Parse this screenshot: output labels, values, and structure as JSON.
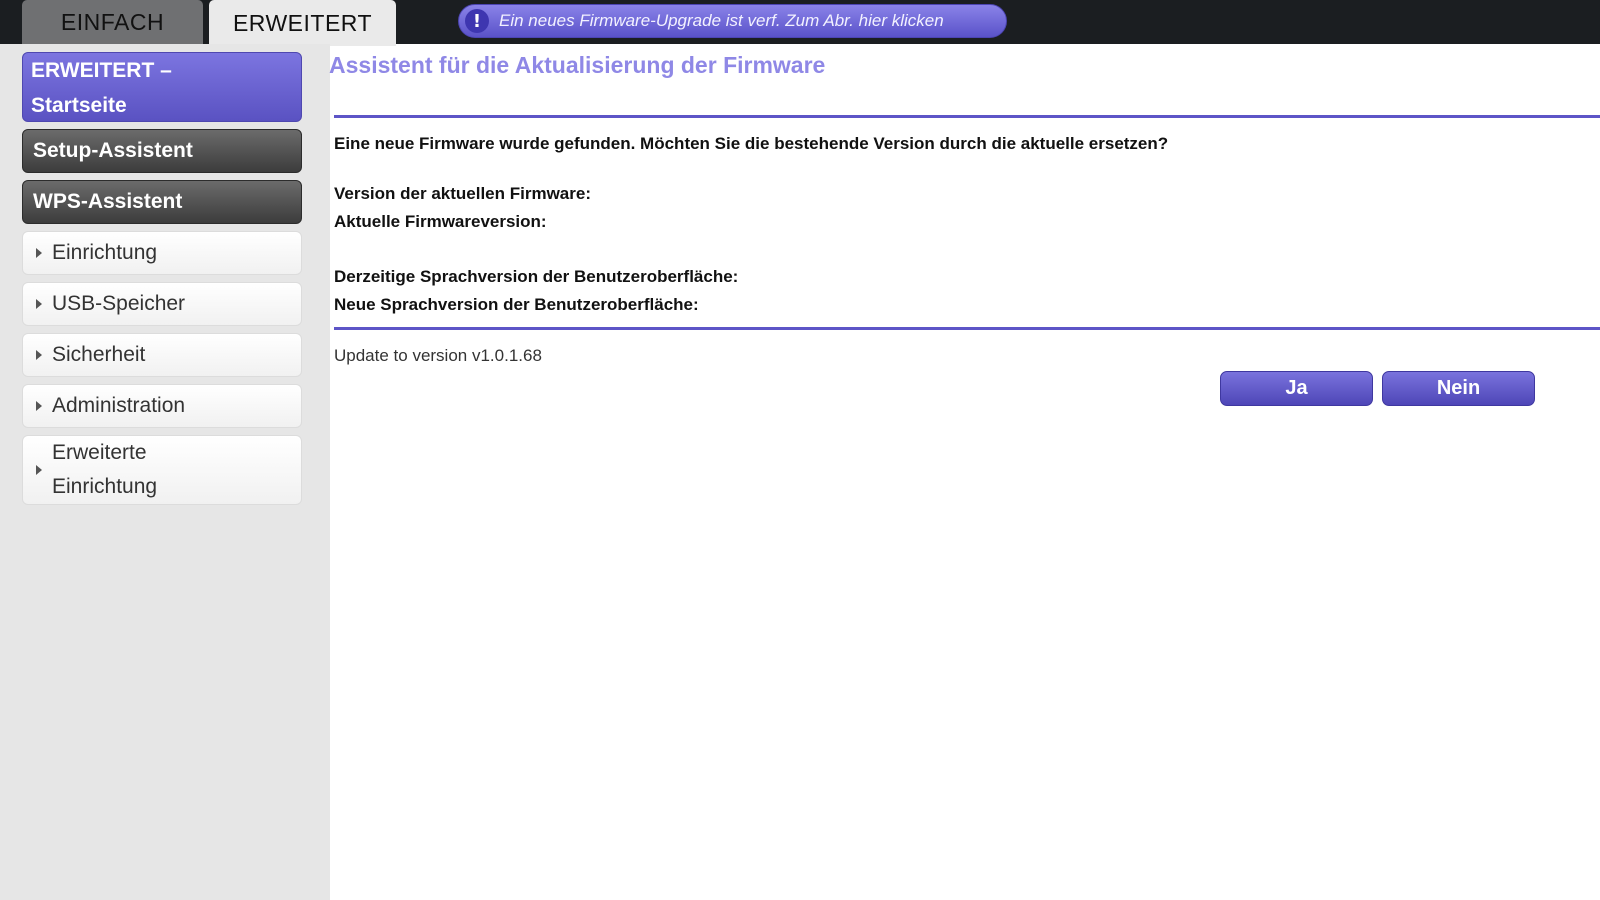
{
  "tabs": {
    "simple": "EINFACH",
    "advanced": "ERWEITERT"
  },
  "notice": {
    "icon": "!",
    "text": "Ein neues Firmware-Upgrade ist verf. Zum Abr. hier klicken"
  },
  "sidebar": {
    "home_line1": "ERWEITERT –",
    "home_line2": "Startseite",
    "setup_wizard": "Setup-Assistent",
    "wps_wizard": "WPS-Assistent",
    "items": [
      {
        "label": "Einrichtung"
      },
      {
        "label": "USB-Speicher"
      },
      {
        "label": "Sicherheit"
      },
      {
        "label": "Administration"
      },
      {
        "label_line1": "Erweiterte",
        "label_line2": "Einrichtung"
      }
    ]
  },
  "main": {
    "title": "Assistent für die Aktualisierung der Firmware",
    "question": "Eine neue Firmware wurde gefunden. Möchten Sie die bestehende Version durch die aktuelle ersetzen?",
    "current_firmware_label": "Version der aktuellen Firmware:",
    "new_firmware_label": "Aktuelle Firmwareversion:",
    "current_language_label": "Derzeitige Sprachversion der Benutzeroberfläche:",
    "new_language_label": "Neue Sprachversion der Benutzeroberfläche:",
    "update_text": "Update to version v1.0.1.68",
    "yes_button": "Ja",
    "no_button": "Nein"
  },
  "colors": {
    "accent": "#5d55c7",
    "title": "#8f88e6",
    "topbar": "#1b1e21",
    "sidebar_bg": "#e6e6e6"
  }
}
